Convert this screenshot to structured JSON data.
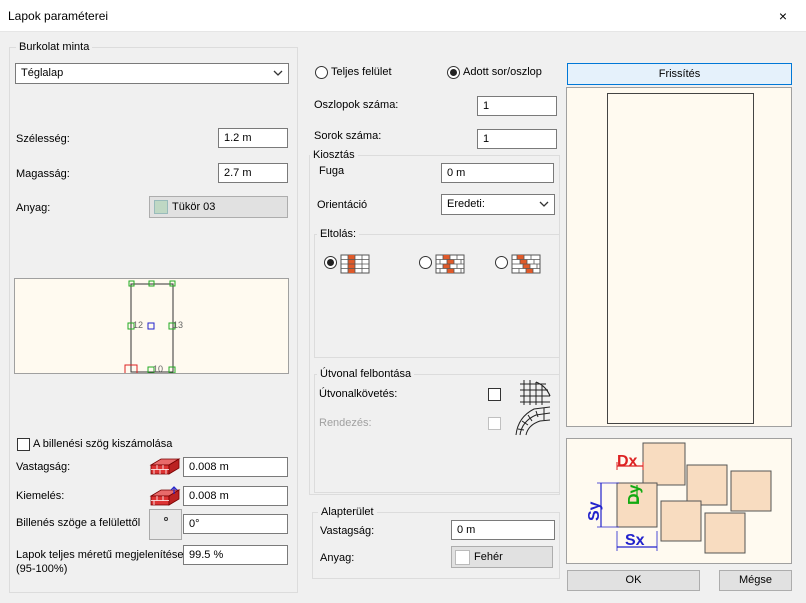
{
  "window": {
    "title": "Lapok paraméterei",
    "close_glyph": "×"
  },
  "left": {
    "pattern_group": "Burkolat minta",
    "pattern_value": "Téglalap",
    "width_label": "Szélesség:",
    "width_value": "1.2 m",
    "height_label": "Magasság:",
    "height_value": "2.7 m",
    "material_label": "Anyag:",
    "material_value": "Tükör 03",
    "material_color": "#bfd8c4",
    "preview_labels": {
      "l12": "12",
      "l13": "13",
      "l10": "10"
    },
    "tilt_checkbox_label": "A billenési szög kiszámolása",
    "thickness_label": "Vastagság:",
    "thickness_value": "0.008 m",
    "raise_label": "Kiemelés:",
    "raise_value": "0.008 m",
    "tilt_angle_label": "Billenés szöge a felülettől",
    "tilt_angle_value": "0°",
    "full_size_label_1": "Lapok teljes méretű megjelenítése",
    "full_size_label_2": "(95-100%)",
    "full_size_value": "99.5 %"
  },
  "middle": {
    "radio_full": "Teljes felület",
    "radio_given": "Adott sor/oszlop",
    "columns_label": "Oszlopok száma:",
    "columns_value": "1",
    "rows_label": "Sorok száma:",
    "rows_value": "1",
    "layout_group": "Kiosztás",
    "joint_label": "Fuga",
    "joint_value": "0 m",
    "orientation_label": "Orientáció",
    "orientation_value": "Eredeti:",
    "offset_group": "Eltolás:",
    "path_group": "Útvonal felbontása",
    "path_follow_label": "Útvonalkövetés:",
    "arrange_label": "Rendezés:",
    "base_group": "Alapterület",
    "base_thickness_label": "Vastagság:",
    "base_thickness_value": "0 m",
    "base_material_label": "Anyag:",
    "base_material_value": "Fehér"
  },
  "right": {
    "refresh_label": "Frissítés",
    "diagram": {
      "dx": "Dx",
      "dy": "Dy",
      "sx": "Sx",
      "sy": "Sy"
    },
    "ok_label": "OK",
    "cancel_label": "Mégse"
  }
}
